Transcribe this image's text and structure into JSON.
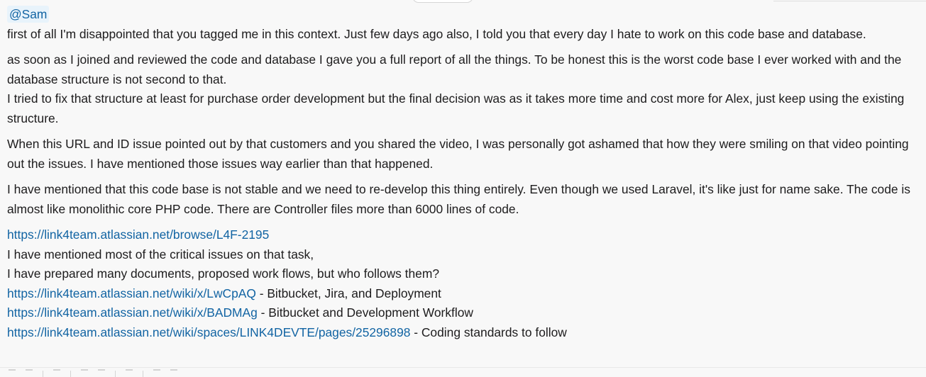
{
  "message": {
    "mention": "@Sam",
    "para1": "first of all I'm disappointed that you tagged me in this context.  Just few days ago also, I told you that every day I hate to work on this code base and database.",
    "para2_line1": "as soon as I joined and reviewed the code and database I gave you a full report of all the things. To be honest this is the worst code base I ever worked with and the database structure is not second to that.",
    "para2_line2": "I tried to fix that structure at least for purchase order development but the final decision was as it takes more time and cost more for Alex, just keep using the existing structure.",
    "para3": "When this URL and ID issue pointed out by that customers and you shared the video, I was personally got ashamed that how they were smiling on that video pointing out the issues. I have mentioned those issues way earlier than that happened.",
    "para4": "I have mentioned that this code base is not stable and we need to re-develop this thing entirely. Even though we used Laravel, it's like just for name sake. The code is almost like monolithic core PHP code. There are Controller files more than 6000 lines of code.",
    "task_link": "https://link4team.atlassian.net/browse/L4F-2195",
    "line_issues": "I have mentioned most of the critical issues on that task,",
    "line_docs": "I have prepared many documents, proposed work flows, but who follows them?",
    "doc_links": [
      {
        "url": "https://link4team.atlassian.net/wiki/x/LwCpAQ",
        "desc": " - Bitbucket, Jira, and Deployment"
      },
      {
        "url": "https://link4team.atlassian.net/wiki/x/BADMAg",
        "desc": " - Bitbucket and Development Workflow"
      },
      {
        "url": "https://link4team.atlassian.net/wiki/spaces/LINK4DEVTE/pages/25296898",
        "desc": " - Coding standards to follow"
      }
    ]
  },
  "colors": {
    "link": "#1264a3",
    "mention_bg": "#e8f3fb",
    "text": "#1d1c1d",
    "background": "#f8f8f8"
  }
}
